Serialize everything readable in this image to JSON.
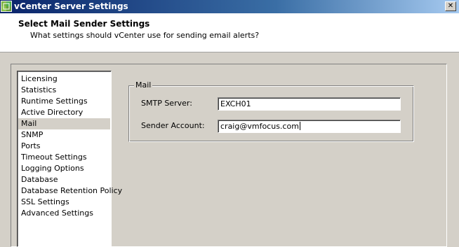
{
  "window": {
    "title": "vCenter Server Settings",
    "close_glyph": "✕"
  },
  "header": {
    "title": "Select Mail Sender Settings",
    "subtitle": "What settings should vCenter use for sending email alerts?"
  },
  "sidebar": {
    "items": [
      {
        "label": "Licensing"
      },
      {
        "label": "Statistics"
      },
      {
        "label": "Runtime Settings"
      },
      {
        "label": "Active Directory"
      },
      {
        "label": "Mail"
      },
      {
        "label": "SNMP"
      },
      {
        "label": "Ports"
      },
      {
        "label": "Timeout Settings"
      },
      {
        "label": "Logging Options"
      },
      {
        "label": "Database"
      },
      {
        "label": "Database Retention Policy"
      },
      {
        "label": "SSL Settings"
      },
      {
        "label": "Advanced Settings"
      }
    ],
    "selected": "Mail"
  },
  "mail": {
    "group_label": "Mail",
    "smtp_label": "SMTP Server:",
    "smtp_value": "EXCH01",
    "sender_label": "Sender Account:",
    "sender_value": "craig@vmfocus.com"
  },
  "icons": {
    "app": "vmware-app-icon",
    "close": "close-icon"
  }
}
